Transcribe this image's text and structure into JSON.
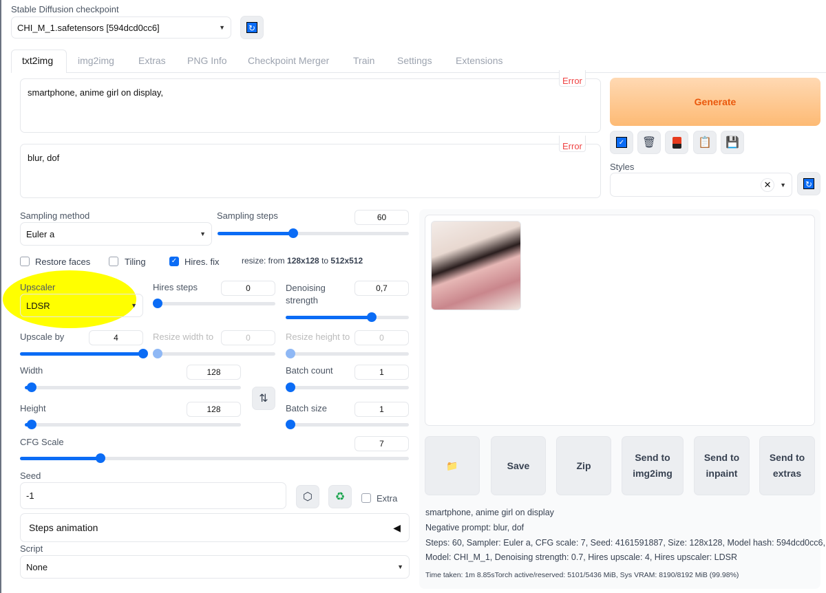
{
  "checkpoint": {
    "label": "Stable Diffusion checkpoint",
    "value": "CHI_M_1.safetensors [594dcd0cc6]"
  },
  "tabs": [
    {
      "label": "txt2img",
      "active": true
    },
    {
      "label": "img2img"
    },
    {
      "label": "Extras"
    },
    {
      "label": "PNG Info"
    },
    {
      "label": "Checkpoint Merger"
    },
    {
      "label": "Train"
    },
    {
      "label": "Settings"
    },
    {
      "label": "Extensions"
    }
  ],
  "prompt": {
    "value": "smartphone, anime girl on display,",
    "error": "Error"
  },
  "negative_prompt": {
    "value": "blur, dof",
    "error": "Error"
  },
  "generate_label": "Generate",
  "tool_icons": [
    "checkbox-pen-icon",
    "trash-icon",
    "red-card-icon",
    "clipboard-icon",
    "floppy-disk-icon"
  ],
  "styles": {
    "label": "Styles",
    "value": ""
  },
  "sampling_method": {
    "label": "Sampling method",
    "value": "Euler a"
  },
  "sampling_steps": {
    "label": "Sampling steps",
    "value": 60,
    "min": 1,
    "max": 150
  },
  "checkboxes": [
    {
      "label": "Restore faces",
      "checked": false
    },
    {
      "label": "Tiling",
      "checked": false
    },
    {
      "label": "Hires. fix",
      "checked": true
    }
  ],
  "resize_info": {
    "prefix": "resize: from ",
    "from": "128x128",
    "mid": " to ",
    "to": "512x512"
  },
  "upscaler": {
    "label": "Upscaler",
    "value": "LDSR"
  },
  "hires_steps": {
    "label": "Hires steps",
    "value": 0,
    "min": 0,
    "max": 150
  },
  "denoising": {
    "label": "Denoising strength",
    "value": "0,7",
    "fraction": 0.7
  },
  "upscale_by": {
    "label": "Upscale by",
    "value": 4,
    "min": 1,
    "max": 4
  },
  "resize_width": {
    "label": "Resize width to",
    "value": 0,
    "min": 0,
    "max": 2048
  },
  "resize_height": {
    "label": "Resize height to",
    "value": 0,
    "min": 0,
    "max": 2048
  },
  "width": {
    "label": "Width",
    "value": 128,
    "min": 64,
    "max": 2048
  },
  "height": {
    "label": "Height",
    "value": 128,
    "min": 64,
    "max": 2048
  },
  "batch_count": {
    "label": "Batch count",
    "value": 1,
    "min": 1,
    "max": 100
  },
  "batch_size": {
    "label": "Batch size",
    "value": 1,
    "min": 1,
    "max": 8
  },
  "cfg_scale": {
    "label": "CFG Scale",
    "value": 7,
    "min": 1,
    "max": 30
  },
  "seed": {
    "label": "Seed",
    "value": "-1",
    "extra_label": "Extra"
  },
  "steps_animation": "Steps animation",
  "script": {
    "label": "Script",
    "value": "None"
  },
  "output_buttons": [
    "Save",
    "Zip",
    "Send to img2img",
    "Send to inpaint",
    "Send to extras"
  ],
  "info": {
    "prompt": "smartphone, anime girl on display",
    "negative": "Negative prompt: blur, dof",
    "params1": "Steps: 60, Sampler: Euler a, CFG scale: 7, Seed: 4161591887, Size: 128x128, Model hash: 594dcd0cc6,",
    "params2": "Model: CHI_M_1, Denoising strength: 0.7, Hires upscale: 4, Hires upscaler: LDSR",
    "time": "Time taken: 1m 8.85sTorch active/reserved: 5101/5436 MiB, Sys VRAM: 8190/8192 MiB (99.98%)"
  },
  "colors": {
    "accent": "#0b6cf5",
    "generate": "#f97316",
    "error": "#ef4444",
    "highlight": "#ffff00"
  }
}
